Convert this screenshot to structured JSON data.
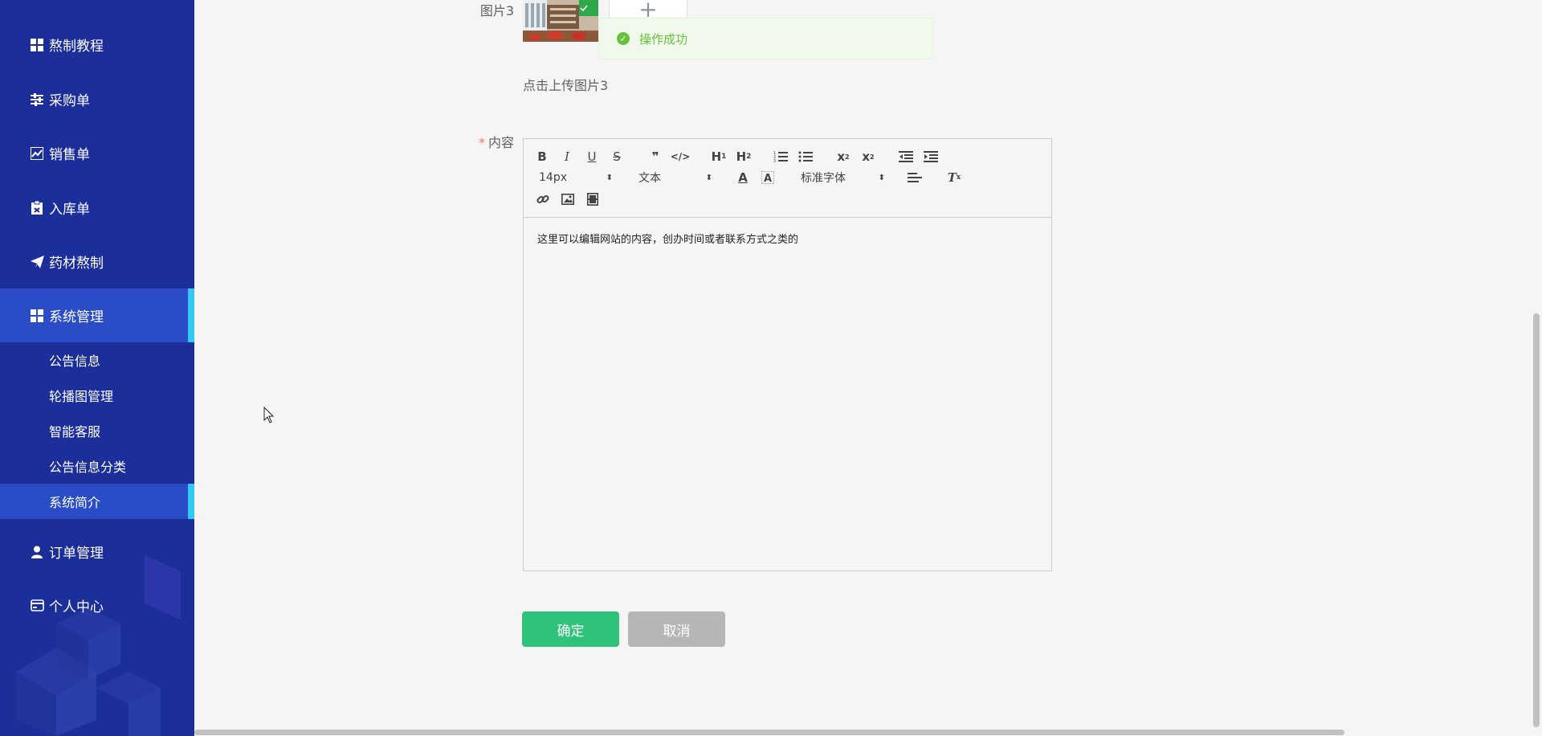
{
  "sidebar": {
    "menu": [
      {
        "label": "熬制教程",
        "icon": "grid-icon"
      },
      {
        "label": "采购单",
        "icon": "sliders-icon"
      },
      {
        "label": "销售单",
        "icon": "chart-icon"
      },
      {
        "label": "入库单",
        "icon": "clipboard-icon"
      },
      {
        "label": "药材熬制",
        "icon": "send-icon"
      },
      {
        "label": "系统管理",
        "icon": "grid-icon"
      },
      {
        "label": "订单管理",
        "icon": "user-icon"
      },
      {
        "label": "个人中心",
        "icon": "card-icon"
      }
    ],
    "submenu": [
      {
        "label": "公告信息"
      },
      {
        "label": "轮播图管理"
      },
      {
        "label": "智能客服"
      },
      {
        "label": "公告信息分类"
      },
      {
        "label": "系统简介"
      }
    ]
  },
  "form": {
    "image3_label": "图片3",
    "upload_hint": "点击上传图片3",
    "content_label": "内容",
    "required_mark": "*",
    "upload_plus": "+"
  },
  "toast": {
    "message": "操作成功"
  },
  "editor": {
    "toolbar": {
      "font_size": "14px",
      "header_select": "文本",
      "font_family": "标准字体"
    },
    "content": "这里可以编辑网站的内容，创办时间或者联系方式之类的"
  },
  "buttons": {
    "confirm": "确定",
    "cancel": "取消"
  },
  "colors": {
    "sidebar_bg": "#1b2e99",
    "active_bg": "#2a4dc7",
    "active_bar": "#32c8f0",
    "confirm": "#2fc27a",
    "cancel": "#b6b6b6",
    "success": "#67c23a"
  }
}
